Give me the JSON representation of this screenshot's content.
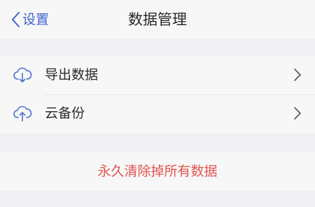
{
  "navbar": {
    "back_label": "设置",
    "title": "数据管理"
  },
  "menu": {
    "items": [
      {
        "label": "导出数据",
        "icon": "cloud-download-icon"
      },
      {
        "label": "云备份",
        "icon": "cloud-upload-icon"
      }
    ]
  },
  "danger": {
    "label": "永久清除掉所有数据"
  },
  "colors": {
    "accent": "#3d63d1",
    "danger": "#e35550",
    "background": "#efeff4",
    "surface": "#f7f7f7"
  }
}
